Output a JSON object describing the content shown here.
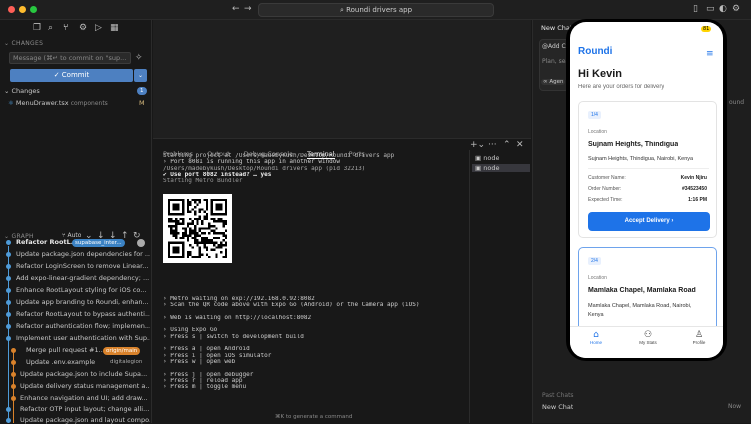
{
  "window": {
    "search_title": "Roundi drivers app"
  },
  "sidebar": {
    "changes_header": "CHANGES",
    "message_placeholder": "Message (⌘↵ to commit on \"sup...",
    "commit_label": "Commit",
    "changes_group": "Changes",
    "changes_count": "1",
    "file_name": "MenuDrawer.tsx",
    "file_dir": "components",
    "file_status": "M",
    "graph_header": "GRAPH",
    "graph_auto": "Auto",
    "commits": [
      "Refactor RootL...",
      "Update package.json dependencies for ...",
      "Refactor LoginScreen to remove Linear...",
      "Add expo-linear-gradient dependency; ...",
      "Enhance RootLayout styling for iOS co...",
      "Update app branding to Roundi, enhan...",
      "Refactor RootLayout to bypass authenti...",
      "Refactor authentication flow; implemen...",
      "Implement user authentication with Sup...",
      "Merge pull request #1...",
      "Update .env.example",
      "Update package.json to include Supa...",
      "Update delivery status management a...",
      "Enhance navigation and UI; add draw...",
      "Refactor OTP input layout; change alli...",
      "Update package.json and layout compo..."
    ],
    "branch_badge": "supabase_inter...",
    "origin_badge": "origin/main",
    "digital_tag": "digitalegion"
  },
  "panel": {
    "tabs": [
      "Problems",
      "Output",
      "Debug Console",
      "Terminal",
      "Ports"
    ],
    "active_tab": "Terminal",
    "terminal_top": [
      "Starting project at /Users/madebykush/Desktop/Roundi drivers app",
      "› Port 8081 is running this app in another window",
      "  /Users/madebykush/Desktop/Roundi drivers app (pid 32213)",
      "✔ Use port 8082 instead? … yes",
      "Starting Metro Bundler"
    ],
    "terminal_bottom": [
      "› Metro waiting on exp://192.168.0.92:8082",
      "› Scan the QR code above with Expo Go (Android) or the Camera app (iOS)",
      "",
      "› Web is waiting on http://localhost:8082",
      "",
      "› Using Expo Go",
      "› Press s │ switch to development build",
      "",
      "› Press a │ open Android",
      "› Press i │ open iOS simulator",
      "› Press w │ open web",
      "",
      "› Press j │ open debugger",
      "› Press r │ reload app",
      "› Press m │ toggle menu"
    ],
    "generate_hint": "⌘K to generate a command",
    "terminals": [
      "node",
      "node"
    ]
  },
  "chat": {
    "tab_title": "New Chat",
    "add_context": "Add C",
    "plan_placeholder": "Plan, sea",
    "agent_label": "Agen",
    "side_text": "ound",
    "past_chats_header": "Past Chats",
    "past_chat_item": "New Chat",
    "past_chat_time": "Now"
  },
  "phone": {
    "notification_badge": "81",
    "brand": "Roundi",
    "greeting": "Hi Kevin",
    "subtitle": "Here are your orders for delivery",
    "orders": [
      {
        "index": "1/4",
        "location_label": "Location",
        "location_title": "Sujnam Heights, Thindigua",
        "address": "Sujnam Heights, Thindigua, Nairobi, Kenya",
        "customer_label": "Customer Name:",
        "customer_value": "Kevin Njiru",
        "order_label": "Order Number:",
        "order_value": "#34523450",
        "time_label": "Expected Time:",
        "time_value": "1:16 PM",
        "button": "Accept Delivery"
      },
      {
        "index": "2/4",
        "location_label": "Location",
        "location_title": "Mamlaka Chapel, Mamlaka Road",
        "address_line1": "Mamlaka Chapel, Mamlaka Road, Nairobi,",
        "address_line2": "Kenya"
      }
    ],
    "nav": [
      "Home",
      "My Stats",
      "Profile"
    ]
  },
  "colors": {
    "accent": "#1e73e8",
    "commit_button": "#4d80c1",
    "branch_badge": "#3b82c4",
    "origin_badge": "#d9822b"
  }
}
